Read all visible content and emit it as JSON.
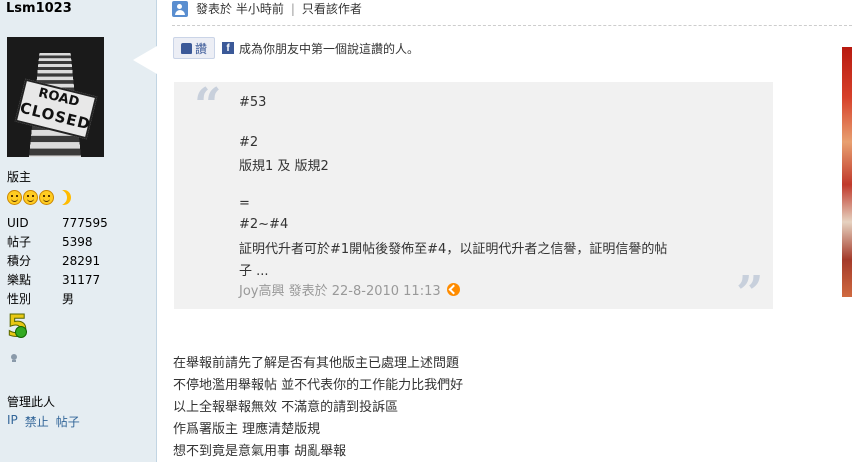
{
  "user": {
    "name": "Lsm1023",
    "avatar_text": [
      "ROAD",
      "CLOSED"
    ],
    "role": "版主",
    "stats": [
      {
        "label": "UID",
        "value": "777595"
      },
      {
        "label": "帖子",
        "value": "5398"
      },
      {
        "label": "積分",
        "value": "28291"
      },
      {
        "label": "樂點",
        "value": "31177"
      },
      {
        "label": "性別",
        "value": "男"
      }
    ],
    "badge_number": "5",
    "admin_title": "管理此人",
    "admin_links": [
      "IP",
      "禁止",
      "帖子"
    ]
  },
  "post": {
    "meta_posted": "發表於 半小時前",
    "meta_separator": "|",
    "meta_author_only": "只看該作者",
    "like_label": "讚",
    "fb_icon_letter": "f",
    "like_text": "成為你朋友中第一個說這讚的人。",
    "quote": {
      "open_mark": "“",
      "close_mark": "”",
      "lines": [
        "#53",
        "#2",
        "版規1 及 版規2",
        "=",
        "#2~#4",
        "証明代升者可於#1開帖後發佈至#4，以証明代升者之信譽，証明信譽的帖",
        "子 ..."
      ],
      "signature": "Joy高興 發表於 22-8-2010 11:13"
    },
    "body_lines": [
      "在舉報前請先了解是否有其他版主已處理上述問題",
      "不停地濫用舉報帖 並不代表你的工作能力比我們好",
      "以上全報舉報無效 不滿意的請到投訴區",
      "作爲署版主 理應清楚版規",
      "想不到竟是意氣用事 胡亂舉報"
    ]
  },
  "colors": {
    "sidebar_bg": "#e5edf2",
    "quote_bg": "#f1f1f1",
    "link": "#336699",
    "facebook": "#3b5998"
  }
}
